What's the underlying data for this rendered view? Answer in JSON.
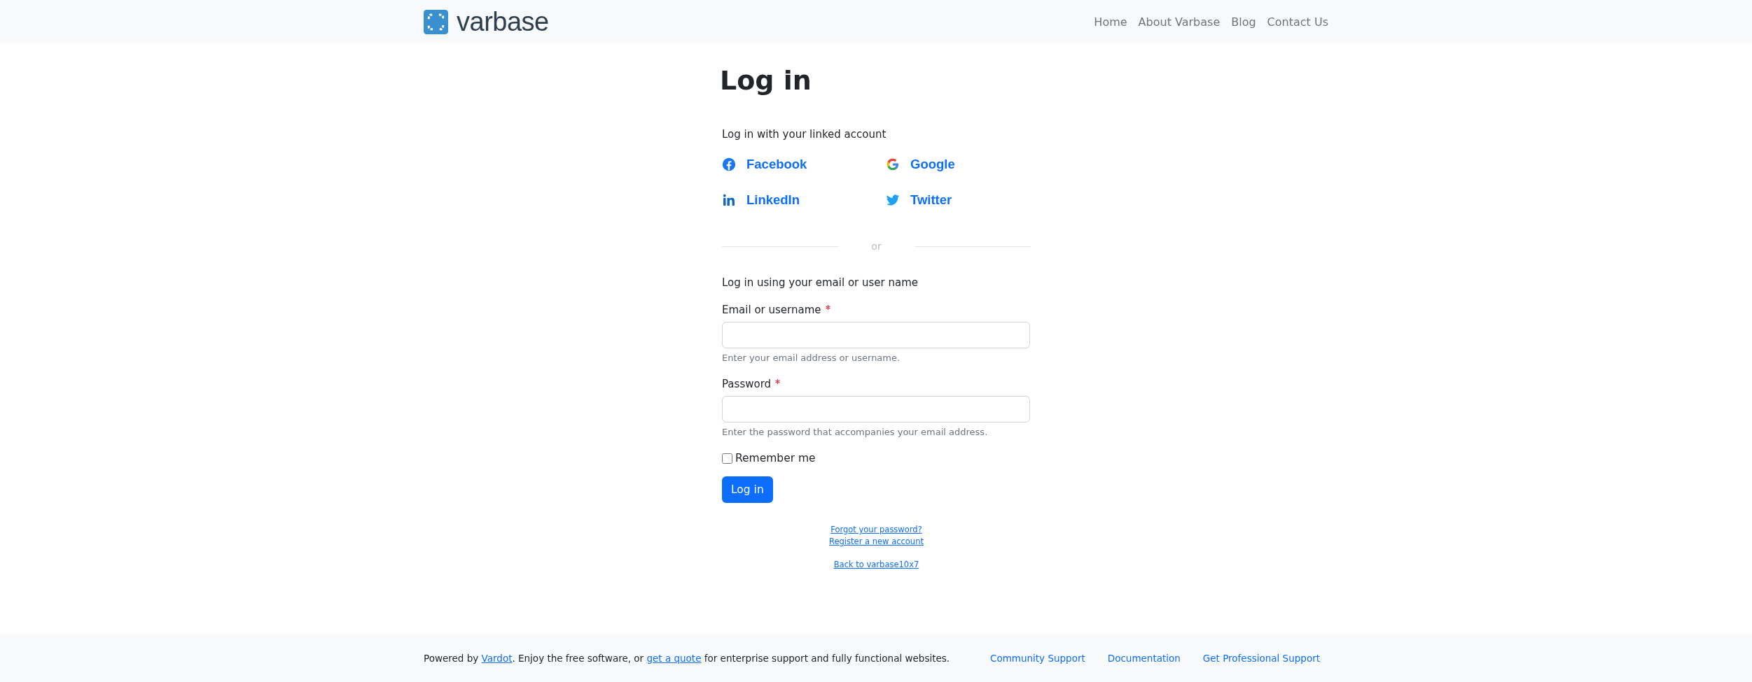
{
  "header": {
    "logo_text": "varbase",
    "nav": [
      {
        "label": "Home"
      },
      {
        "label": "About Varbase"
      },
      {
        "label": "Blog"
      },
      {
        "label": "Contact Us"
      }
    ]
  },
  "login": {
    "title": "Log in",
    "social_intro": "Log in with your linked account",
    "providers": [
      {
        "kind": "facebook",
        "label": "Facebook"
      },
      {
        "kind": "google",
        "label": "Google"
      },
      {
        "kind": "linkedin",
        "label": "LinkedIn"
      },
      {
        "kind": "twitter",
        "label": "Twitter"
      }
    ],
    "divider": "or",
    "form_intro": "Log in using your email or user name",
    "fields": [
      {
        "label": "Email or username",
        "required": true,
        "help": "Enter your email address or username."
      },
      {
        "label": "Password",
        "required": true,
        "help": "Enter the password that accompanies your email address."
      }
    ],
    "remember": {
      "label": "Remember me",
      "checked": false
    },
    "submit": "Log in",
    "link_groups": [
      {
        "links": [
          {
            "label": "Forgot your password?"
          },
          {
            "label": "Register a new account"
          }
        ]
      },
      {
        "links": [
          {
            "label": "Back to varbase10x7"
          }
        ]
      }
    ]
  },
  "footer": {
    "text": [
      {
        "text": "Powered by "
      },
      {
        "link": "Vardot"
      },
      {
        "text": ". Enjoy the free software, or "
      },
      {
        "link": "get a quote"
      },
      {
        "text": " for enterprise support and fully functional websites."
      }
    ],
    "links": [
      {
        "label": "Community Support"
      },
      {
        "label": "Documentation"
      },
      {
        "label": "Get Professional Support"
      }
    ]
  }
}
